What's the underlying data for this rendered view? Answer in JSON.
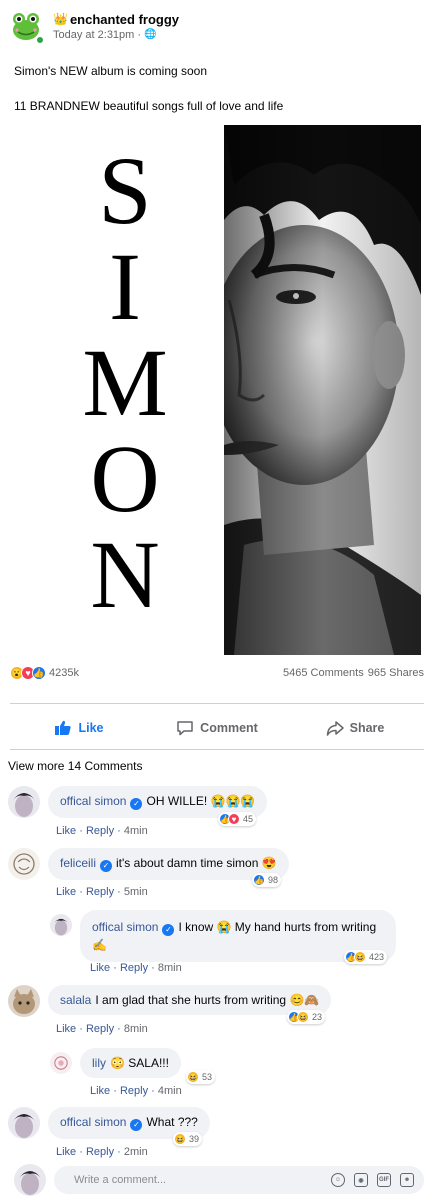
{
  "post": {
    "author": "enchanted froggy",
    "author_badge_icon": "crown-emoji",
    "timestamp": "Today at 2:31pm",
    "privacy_icon": "globe-icon",
    "text_line1": "Simon's NEW album is coming soon",
    "text_line2": "11 BRANDNEW beautiful songs full of love and life",
    "image": {
      "letters": [
        "S",
        "I",
        "M",
        "O",
        "N"
      ]
    },
    "reactions_count": "4235k",
    "comments_count": "5465 Comments",
    "shares_count": "965 Shares"
  },
  "actions": {
    "like": "Like",
    "comment": "Comment",
    "share": "Share"
  },
  "view_more": "View more 14 Comments",
  "comments": [
    {
      "name": "offical simon",
      "verified": true,
      "text": "OH WILLE! 😭😭😭",
      "like": "Like",
      "reply": "Reply",
      "time": "4min",
      "reaction_count": "45"
    },
    {
      "name": "feliceili",
      "verified": true,
      "text": "it's about damn time simon 😍",
      "like": "Like",
      "reply": "Reply",
      "time": "5min",
      "reaction_count": "98"
    },
    {
      "name": "offical simon",
      "verified": true,
      "text": "I know 😭 My hand hurts from writing ✍",
      "like": "Like",
      "reply": "Reply",
      "time": "8min",
      "reaction_count": "423"
    },
    {
      "name": "salala",
      "verified": false,
      "text": "I am glad that she hurts from writing 😊🙈",
      "like": "Like",
      "reply": "Reply",
      "time": "8min",
      "reaction_count": "23"
    },
    {
      "name": "lily",
      "verified": false,
      "text": "😳 SALA!!!",
      "like": "Like",
      "reply": "Reply",
      "time": "4min",
      "reaction_count": "53"
    },
    {
      "name": "offical simon",
      "verified": true,
      "text": "What ???",
      "like": "Like",
      "reply": "Reply",
      "time": "2min",
      "reaction_count": "39"
    }
  ],
  "write_comment": {
    "placeholder": "Write a comment...",
    "icons": [
      "emoji-icon",
      "camera-icon",
      "gif-icon",
      "sticker-icon"
    ]
  },
  "colors": {
    "link": "#385898",
    "like_blue": "#1877f2",
    "love_red": "#f33e58",
    "emoji_yellow": "#f7b125",
    "bubble_bg": "#f0f2f5",
    "muted": "#65676b"
  }
}
